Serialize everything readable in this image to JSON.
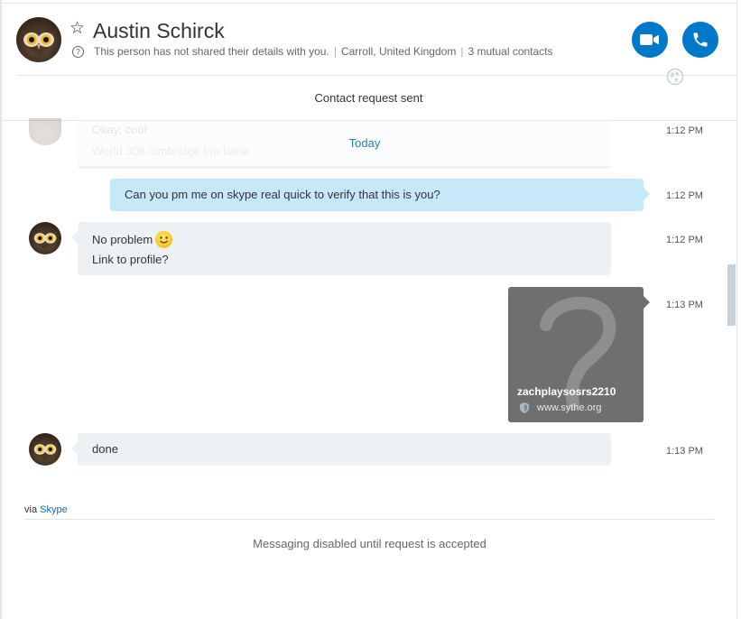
{
  "header": {
    "contact_name": "Austin Schirck",
    "info_text": "This person has not shared their details with you.",
    "location": "Carroll, United Kingdom",
    "mutual_contacts": "3 mutual contacts",
    "separator": "|",
    "accent_color": "#0078ca",
    "icons": {
      "favorite": "star-outline-icon",
      "info": "question-circle-icon",
      "video": "video-camera-icon",
      "audio": "phone-icon",
      "globe": "globe-icon"
    }
  },
  "request_banner": "Contact request sent",
  "conversation": {
    "faded_message": {
      "line1": "Okay, cool",
      "line2": "World 308 lumbridge top bank",
      "time": "1:12 PM"
    },
    "date_divider": "Today",
    "messages": [
      {
        "direction": "outgoing",
        "text": "Can you pm me on skype real quick to verify that this is you?",
        "time": "1:12 PM"
      },
      {
        "direction": "incoming",
        "line1": "No problem",
        "line2": "Link to profile?",
        "emoji": "smile-emoji",
        "time": "1:12 PM"
      },
      {
        "direction": "outgoing",
        "type": "link-preview",
        "card_title": "zachplaysosrs2210",
        "card_url": "www.sythe.org",
        "time": "1:13 PM"
      },
      {
        "direction": "incoming",
        "text": "done",
        "time": "1:13 PM"
      }
    ]
  },
  "footer": {
    "via_prefix": "via",
    "via_link": "Skype",
    "disabled_text": "Messaging disabled until request is accepted"
  }
}
